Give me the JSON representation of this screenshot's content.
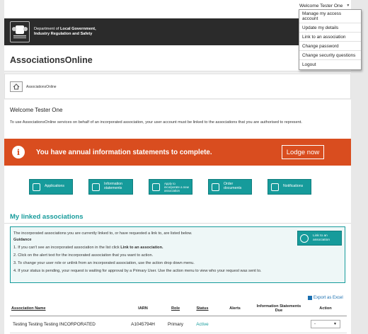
{
  "header": {
    "dept_line1_prefix": "Department of ",
    "dept_line1_bold": "Local Government,",
    "dept_line2": "Industry Regulation and Safety",
    "crest_label": "GOVERNMENT OF WESTERN AUSTRALIA"
  },
  "user_menu": {
    "label": "Welcome Tester One",
    "items": [
      "Manage my access account",
      "Update my details",
      "Link to an association",
      "Change password",
      "Change security questions",
      "Logout"
    ]
  },
  "app_title": "AssociationsOnline",
  "breadcrumb": {
    "current": "AssociationsOnline"
  },
  "welcome": "Welcome Tester One",
  "intro": "To use AssociationsOnline services on behalf of an incorporated association, your user account must be linked to the associations that you are authorised to represent.",
  "alert": {
    "icon": "info-icon",
    "text": "You have annual information statements to complete.",
    "button": "Lodge now",
    "color": "#d94d1f"
  },
  "tiles": [
    {
      "label": "Applications",
      "icon": "applications-icon"
    },
    {
      "label": "Information statements",
      "icon": "information-statements-icon"
    },
    {
      "label": "Apply to incorporate a new association",
      "icon": "apply-incorporate-icon"
    },
    {
      "label": "Order documents",
      "icon": "order-documents-icon"
    },
    {
      "label": "Notifications",
      "icon": "notifications-icon"
    }
  ],
  "accent_color": "#169b9b",
  "linked": {
    "heading": "My linked associations",
    "intro": "The incorporated associations you are currently linked to, or have requested a link to, are listed below.",
    "guidance_heading": "Guidance",
    "guidance": [
      {
        "before": "1. If you can't see an incorporated association in the list click ",
        "bold": "Link to an association.",
        "after": ""
      },
      {
        "before": "2. Click on the alert text for the incorporated association that you want to action.",
        "bold": "",
        "after": ""
      },
      {
        "before": "3. To change your user role or unlink from an incorporated association, use the action drop down menu.",
        "bold": "",
        "after": ""
      },
      {
        "before": "4. If your status is pending, your request is waiting for approval by a Primary User. Use the action menu to view who your request was sent to.",
        "bold": "",
        "after": ""
      }
    ],
    "link_button": "Link to an association",
    "export": "Export as Excel"
  },
  "table": {
    "headers": [
      "Association Name",
      "IARN",
      "Role",
      "Status",
      "Alerts",
      "Information Statements Due",
      "Action"
    ],
    "rows": [
      {
        "name": "Testing Testing Testing INCORPORATED",
        "iarn": "A1045794H",
        "role": "Primary",
        "status": "Active",
        "alerts": "",
        "due": "",
        "action": "-"
      }
    ]
  }
}
